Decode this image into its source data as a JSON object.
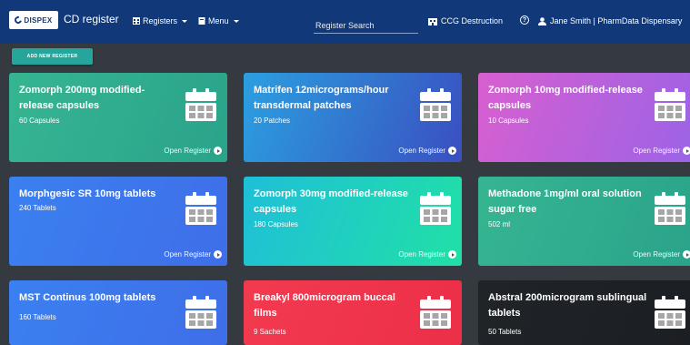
{
  "navbar": {
    "logo_text": "DISPEX",
    "app_title": "CD register",
    "registers_label": "Registers",
    "menu_label": "Menu",
    "search_placeholder": "Register Search",
    "destruction_label": "CCG Destruction",
    "user_label": "Jane Smith | PharmData Dispensary",
    "bg_color": "#11397a"
  },
  "actions": {
    "add_label": "ADD NEW REGISTER"
  },
  "cards": [
    {
      "name": "Zomorph 200mg modified-release capsules",
      "qty": "60 Capsules",
      "open_label": "Open Register",
      "gradient": "#36b592,#2aa38a"
    },
    {
      "name": "Matrifen 12micrograms/hour transdermal patches",
      "qty": "20 Patches",
      "open_label": "Open Register",
      "gradient": "#2b9fe0,#3a4fc0"
    },
    {
      "name": "Zomorph 10mg modified-release capsules",
      "qty": "10 Capsules",
      "open_label": "Open Register",
      "gradient": "#d85fd0,#9b63e6"
    },
    {
      "name": "Morphgesic SR 10mg tablets",
      "qty": "240 Tablets",
      "open_label": "Open Register",
      "gradient": "#3a80f0,#3f6ee8"
    },
    {
      "name": "Zomorph 30mg modified-release capsules",
      "qty": "180 Capsules",
      "open_label": "Open Register",
      "gradient": "#1fbfd8,#21e0a6"
    },
    {
      "name": "Methadone 1mg/ml oral solution sugar free",
      "qty": "502 ml",
      "open_label": "Open Register",
      "gradient": "#36b592,#2aa38a"
    },
    {
      "name": "MST Continus 100mg tablets",
      "qty": "160 Tablets",
      "open_label": "Open Register",
      "gradient": "#3a80f0,#3f6ee8"
    },
    {
      "name": "Breakyl 800microgram buccal films",
      "qty": "9 Sachets",
      "open_label": "Open Register",
      "gradient": "#f23a4f,#ec2f48"
    },
    {
      "name": "Abstral 200microgram sublingual tablets",
      "qty": "50 Tablets",
      "open_label": "Open Register",
      "gradient": "#202429,#1b1e22"
    }
  ]
}
